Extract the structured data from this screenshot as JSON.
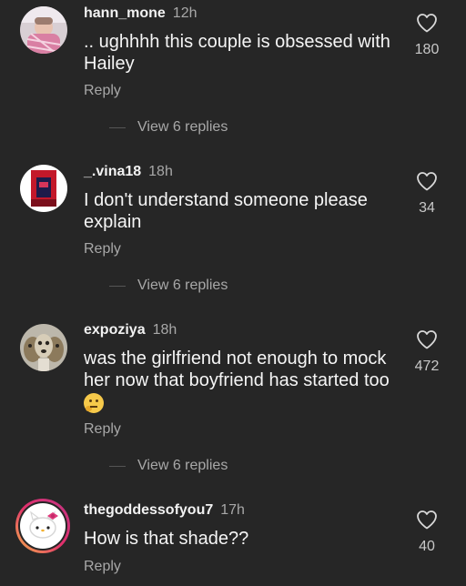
{
  "comments": [
    {
      "username": "hann_mone",
      "time": "12h",
      "text": ".. ughhhh this couple is obsessed with Hailey",
      "reply_label": "Reply",
      "likes": "180",
      "view_replies": "View 6 replies"
    },
    {
      "username": "_.vina18",
      "time": "18h",
      "text": "I don't understand someone please explain",
      "reply_label": "Reply",
      "likes": "34",
      "view_replies": "View 6 replies"
    },
    {
      "username": "expoziya",
      "time": "18h",
      "text": "was the girlfriend not enough to mock her now that boyfriend has started too",
      "emoji": "thinking-face",
      "reply_label": "Reply",
      "likes": "472",
      "view_replies": "View 6 replies"
    },
    {
      "username": "thegoddessofyou7",
      "time": "17h",
      "text": "How is that shade??",
      "reply_label": "Reply",
      "likes": "40"
    }
  ],
  "icons": {
    "like": "heart-outline-icon",
    "emoji": "thinking-face-icon"
  },
  "colors": {
    "background": "#262626",
    "primary_text": "#f5f5f5",
    "secondary_text": "#a8a8a8",
    "story_ring_start": "#f6b34a",
    "story_ring_end": "#c13584"
  }
}
